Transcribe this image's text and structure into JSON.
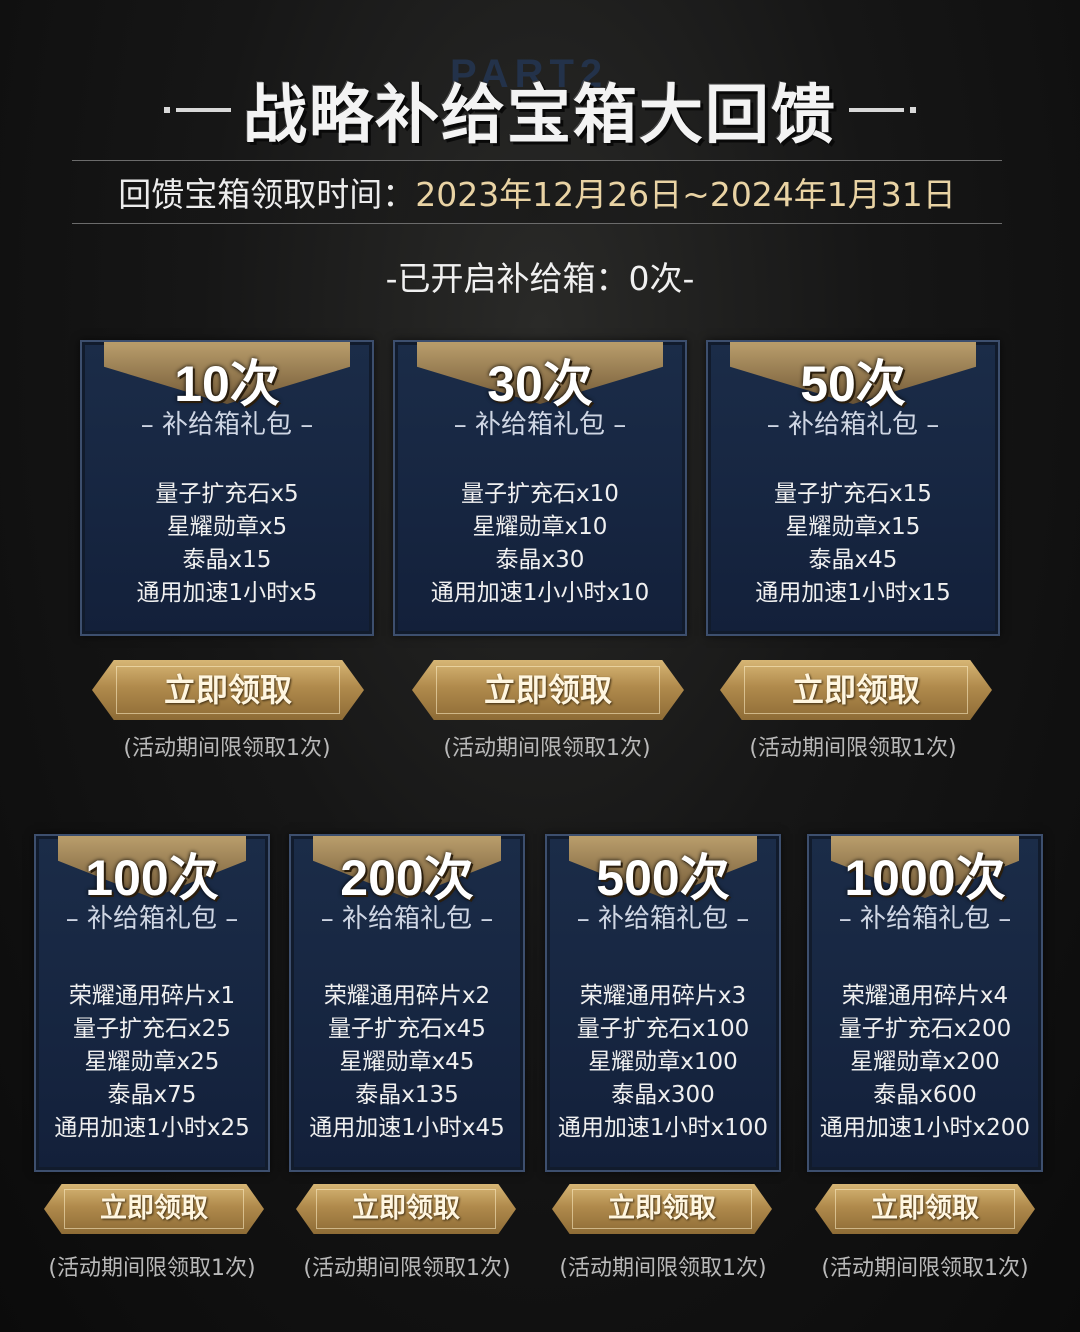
{
  "header": {
    "bg_text": "PART2",
    "title": "战略补给宝箱大回馈",
    "date_label": "回馈宝箱领取时间：",
    "date_value": "2023年12月26日~2024年1月31日",
    "opened": "-已开启补给箱：0次-"
  },
  "common": {
    "package_sub": "– 补给箱礼包 –",
    "claim_label": "立即领取",
    "limit_note": "(活动期间限领取1次)"
  },
  "tiers": [
    {
      "count": "10次",
      "items": [
        "量子扩充石x5",
        "星耀勋章x5",
        "泰晶x15",
        "通用加速1小时x5"
      ]
    },
    {
      "count": "30次",
      "items": [
        "量子扩充石x10",
        "星耀勋章x10",
        "泰晶x30",
        "通用加速1小小时x10"
      ]
    },
    {
      "count": "50次",
      "items": [
        "量子扩充石x15",
        "星耀勋章x15",
        "泰晶x45",
        "通用加速1小时x15"
      ]
    },
    {
      "count": "100次",
      "items": [
        "荣耀通用碎片x1",
        "量子扩充石x25",
        "星耀勋章x25",
        "泰晶x75",
        "通用加速1小时x25"
      ]
    },
    {
      "count": "200次",
      "items": [
        "荣耀通用碎片x2",
        "量子扩充石x45",
        "星耀勋章x45",
        "泰晶x135",
        "通用加速1小时x45"
      ]
    },
    {
      "count": "500次",
      "items": [
        "荣耀通用碎片x3",
        "量子扩充石x100",
        "星耀勋章x100",
        "泰晶x300",
        "通用加速1小时x100"
      ]
    },
    {
      "count": "1000次",
      "items": [
        "荣耀通用碎片x4",
        "量子扩充石x200",
        "星耀勋章x200",
        "泰晶x600",
        "通用加速1小时x200"
      ]
    }
  ],
  "colors": {
    "card_bg": "#1b2c48",
    "gold_accent": "#c2a46e",
    "date_highlight": "#e9d3a4"
  }
}
